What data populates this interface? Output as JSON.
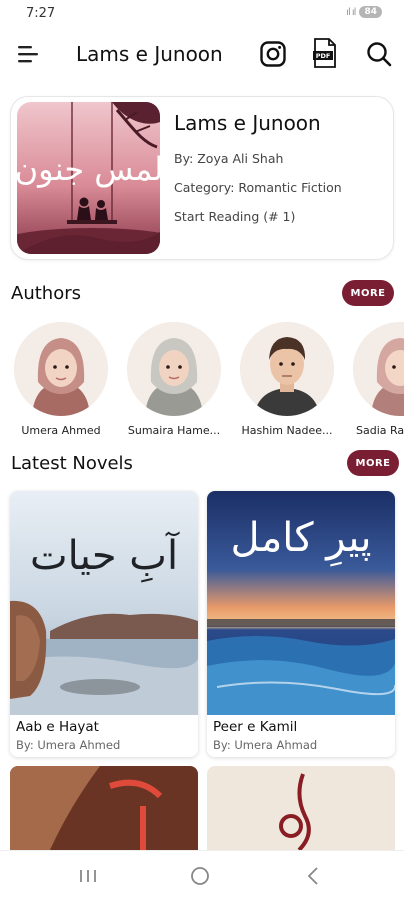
{
  "status_bar": {
    "time": "7:27",
    "signal": "ıl ıl",
    "battery": "84"
  },
  "app_bar": {
    "title": "Lams e Junoon",
    "icons": [
      "menu-icon",
      "instagram-icon",
      "pdf-icon",
      "search-icon"
    ],
    "pdf_badge": "PDF"
  },
  "featured": {
    "cover_text": "لمس جنون",
    "title": "Lams e Junoon",
    "author": "By: Zoya Ali Shah",
    "category": "Category: Romantic Fiction",
    "start": "Start Reading (# 1)"
  },
  "authors": {
    "heading": "Authors",
    "more_label": "MORE",
    "items": [
      {
        "name": "Umera Ahmed"
      },
      {
        "name": "Sumaira Hame..."
      },
      {
        "name": "Hashim Nadee..."
      },
      {
        "name": "Sadia Ra"
      }
    ]
  },
  "latest": {
    "heading": "Latest Novels",
    "more_label": "MORE",
    "items": [
      {
        "title": "Aab e Hayat",
        "author": "By: Umera Ahmed",
        "cover_text": "آبِ حیات"
      },
      {
        "title": "Peer e Kamil",
        "author": "By: Umera Ahmad",
        "cover_text": "پیرِ کامل"
      }
    ]
  },
  "colors": {
    "accent": "#7a1f33",
    "background": "#ffffff",
    "text": "#111111"
  }
}
